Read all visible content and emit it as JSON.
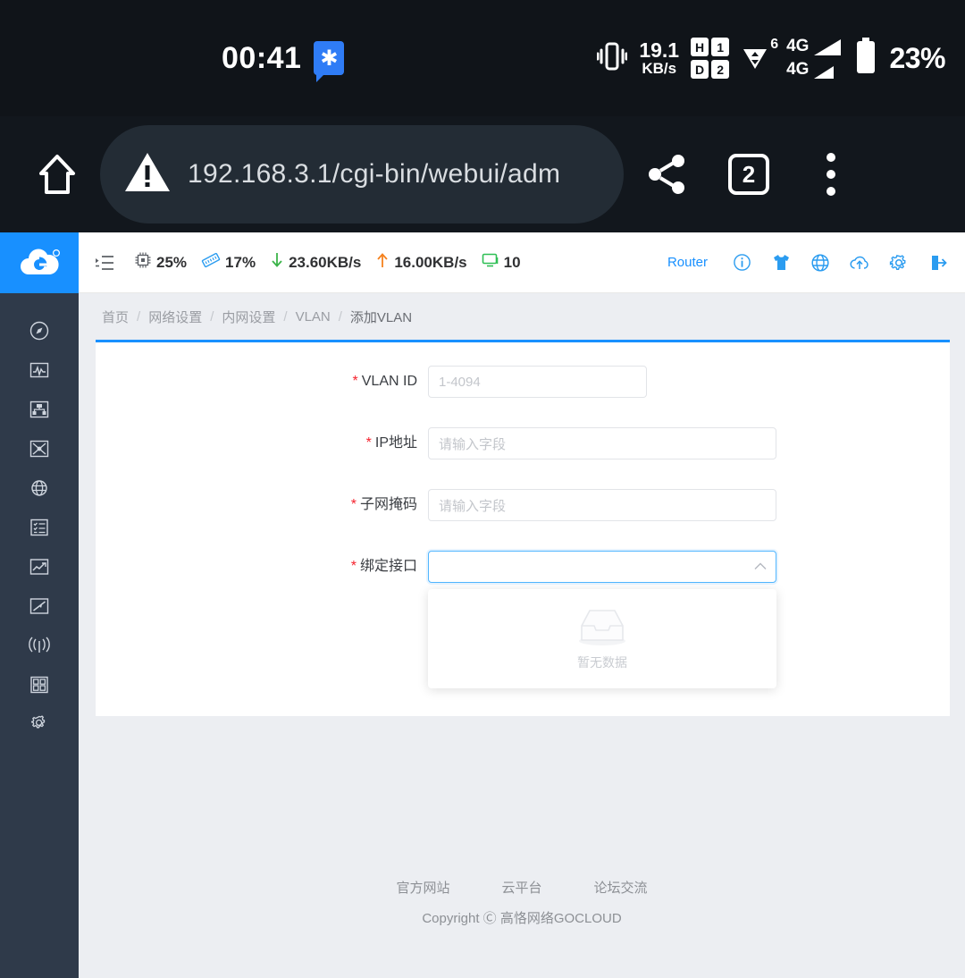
{
  "status_bar": {
    "clock": "00:41",
    "notif_badge": "✱",
    "vibrate_icon": "vibrate-icon",
    "net_speed_value": "19.1",
    "net_speed_unit": "KB/s",
    "sim1_label": "H",
    "sim1_num": "1",
    "sim2_label": "D",
    "sim2_num": "2",
    "wifi_icon": "wifi-icon",
    "wifi_generation": "6",
    "signal1_label": "4G",
    "signal2_label": "4G",
    "battery": "23%"
  },
  "browser": {
    "home_icon": "home-icon",
    "security_icon": "warning-triangle-icon",
    "url": "192.168.3.1/cgi-bin/webui/adm",
    "share_icon": "share-icon",
    "tab_count": "2",
    "menu_icon": "more-vertical-icon"
  },
  "sidebar": {
    "logo_alt": "gocloud-logo",
    "items": [
      {
        "name": "sidebar-item-dashboard",
        "icon": "compass-icon"
      },
      {
        "name": "sidebar-item-monitor",
        "icon": "activity-monitor-icon"
      },
      {
        "name": "sidebar-item-network",
        "icon": "network-topology-icon"
      },
      {
        "name": "sidebar-item-routing",
        "icon": "routing-icon"
      },
      {
        "name": "sidebar-item-internet",
        "icon": "globe-gear-icon"
      },
      {
        "name": "sidebar-item-list",
        "icon": "checklist-icon"
      },
      {
        "name": "sidebar-item-traffic",
        "icon": "line-chart-icon"
      },
      {
        "name": "sidebar-item-bandwidth",
        "icon": "bandwidth-icon"
      },
      {
        "name": "sidebar-item-wireless",
        "icon": "antenna-icon"
      },
      {
        "name": "sidebar-item-apps",
        "icon": "apps-grid-icon"
      },
      {
        "name": "sidebar-item-settings",
        "icon": "gear-icon"
      }
    ]
  },
  "topbar": {
    "collapse_icon": "collapse-sidebar-icon",
    "cpu_icon": "cpu-icon",
    "cpu_value": "25%",
    "memory_icon": "memory-icon",
    "memory_value": "17%",
    "download_icon": "arrow-down-icon",
    "download_value": "23.60KB/s",
    "upload_icon": "arrow-up-icon",
    "upload_value": "16.00KB/s",
    "clients_icon": "monitor-icon",
    "clients_value": "10",
    "mode_label": "Router",
    "info_icon": "info-circle-icon",
    "theme_icon": "tshirt-icon",
    "language_icon": "globe-icon",
    "upgrade_icon": "cloud-upload-icon",
    "settings_icon": "gear-icon",
    "logout_icon": "logout-icon"
  },
  "breadcrumb": {
    "items": [
      "首页",
      "网络设置",
      "内网设置",
      "VLAN",
      "添加VLAN"
    ],
    "separator": "/"
  },
  "form": {
    "fields": [
      {
        "label": "VLAN ID",
        "required": true,
        "placeholder": "1-4094",
        "value": "",
        "type": "text",
        "width": "small"
      },
      {
        "label": "IP地址",
        "required": true,
        "placeholder": "请输入字段",
        "value": "",
        "type": "text",
        "width": "big"
      },
      {
        "label": "子网掩码",
        "required": true,
        "placeholder": "请输入字段",
        "value": "",
        "type": "text",
        "width": "big"
      },
      {
        "label": "绑定接口",
        "required": true,
        "placeholder": "",
        "value": "",
        "type": "select",
        "width": "big"
      }
    ],
    "required_marker": "*",
    "dropdown": {
      "open": true,
      "empty_icon": "empty-box-icon",
      "empty_text": "暂无数据",
      "options": [],
      "caret_icon": "chevron-up-icon"
    }
  },
  "footer": {
    "links": [
      "官方网站",
      "云平台",
      "论坛交流"
    ],
    "copyright": "Copyright Ⓒ 高恪网络GOCLOUD"
  },
  "colors": {
    "accent": "#1890ff",
    "sidebar_bg": "#2f3a4a",
    "page_bg": "#eceef2",
    "required_red": "#f5222d",
    "download_green": "#52c41a",
    "upload_orange": "#fa8c16"
  }
}
